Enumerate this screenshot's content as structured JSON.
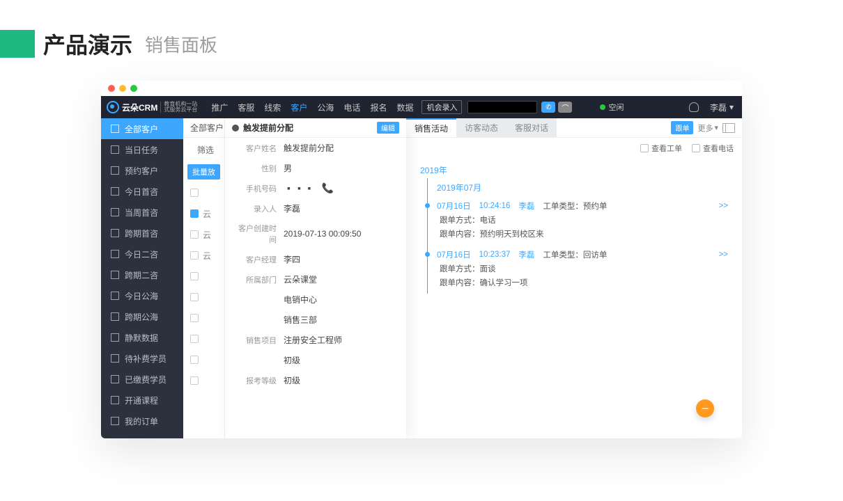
{
  "page": {
    "title": "产品演示",
    "subtitle": "销售面板"
  },
  "logo": {
    "brand": "云朵CRM",
    "tag1": "教育机构一站",
    "tag2": "式服务云平台"
  },
  "nav": {
    "items": [
      "推广",
      "客服",
      "线索",
      "客户",
      "公海",
      "电话",
      "报名",
      "数据"
    ],
    "active_index": 3,
    "special": "机会录入",
    "status": "空闲"
  },
  "user": {
    "name": "李磊"
  },
  "sidebar": {
    "items": [
      {
        "label": "全部客户",
        "active": true
      },
      {
        "label": "当日任务"
      },
      {
        "label": "预约客户"
      },
      {
        "label": "今日首咨"
      },
      {
        "label": "当周首咨"
      },
      {
        "label": "跨期首咨"
      },
      {
        "label": "今日二咨"
      },
      {
        "label": "跨期二咨"
      },
      {
        "label": "今日公海"
      },
      {
        "label": "跨期公海"
      },
      {
        "label": "静默数据"
      },
      {
        "label": "待补费学员"
      },
      {
        "label": "已缴费学员"
      },
      {
        "label": "开通课程"
      },
      {
        "label": "我的订单"
      }
    ]
  },
  "list": {
    "header": "全部客户",
    "filter": "筛选",
    "batch_btn": "批量放",
    "col": "云"
  },
  "detail": {
    "title": "触发提前分配",
    "edit": "编辑",
    "fields": [
      {
        "label": "客户姓名",
        "value": "触发提前分配"
      },
      {
        "label": "性别",
        "value": "男"
      },
      {
        "label": "手机号码",
        "value": "▪️▪️▪️",
        "phone": true
      },
      {
        "label": "录入人",
        "value": "李磊"
      },
      {
        "label": "客户创建时间",
        "value": "2019-07-13 00:09:50"
      },
      {
        "label": "客户经理",
        "value": "李四"
      },
      {
        "label": "所属部门",
        "value": "云朵课堂"
      },
      {
        "label": "",
        "value": "电销中心"
      },
      {
        "label": "",
        "value": "销售三部"
      },
      {
        "label": "销售项目",
        "value": "注册安全工程师"
      },
      {
        "label": "",
        "value": "初级"
      },
      {
        "label": "报考等级",
        "value": "初级"
      }
    ]
  },
  "timeline": {
    "tabs": [
      "销售活动",
      "访客动态",
      "客服对话"
    ],
    "active_tab": 0,
    "badge": "跟单",
    "more": "更多",
    "toolbar": {
      "view_order": "查看工单",
      "view_phone": "查看电话"
    },
    "year": "2019年",
    "month": "2019年07月",
    "entries": [
      {
        "date": "07月16日",
        "time": "10:24:16",
        "person": "李磊",
        "type_label": "工单类型：",
        "type": "预约单",
        "method_label": "跟单方式：",
        "method": "电话",
        "content_label": "跟单内容：",
        "content": "预约明天到校区来",
        "more": ">>"
      },
      {
        "date": "07月16日",
        "time": "10:23:37",
        "person": "李磊",
        "type_label": "工单类型：",
        "type": "回访单",
        "method_label": "跟单方式：",
        "method": "面谈",
        "content_label": "跟单内容：",
        "content": "确认学习一项",
        "more": ">>"
      }
    ]
  }
}
